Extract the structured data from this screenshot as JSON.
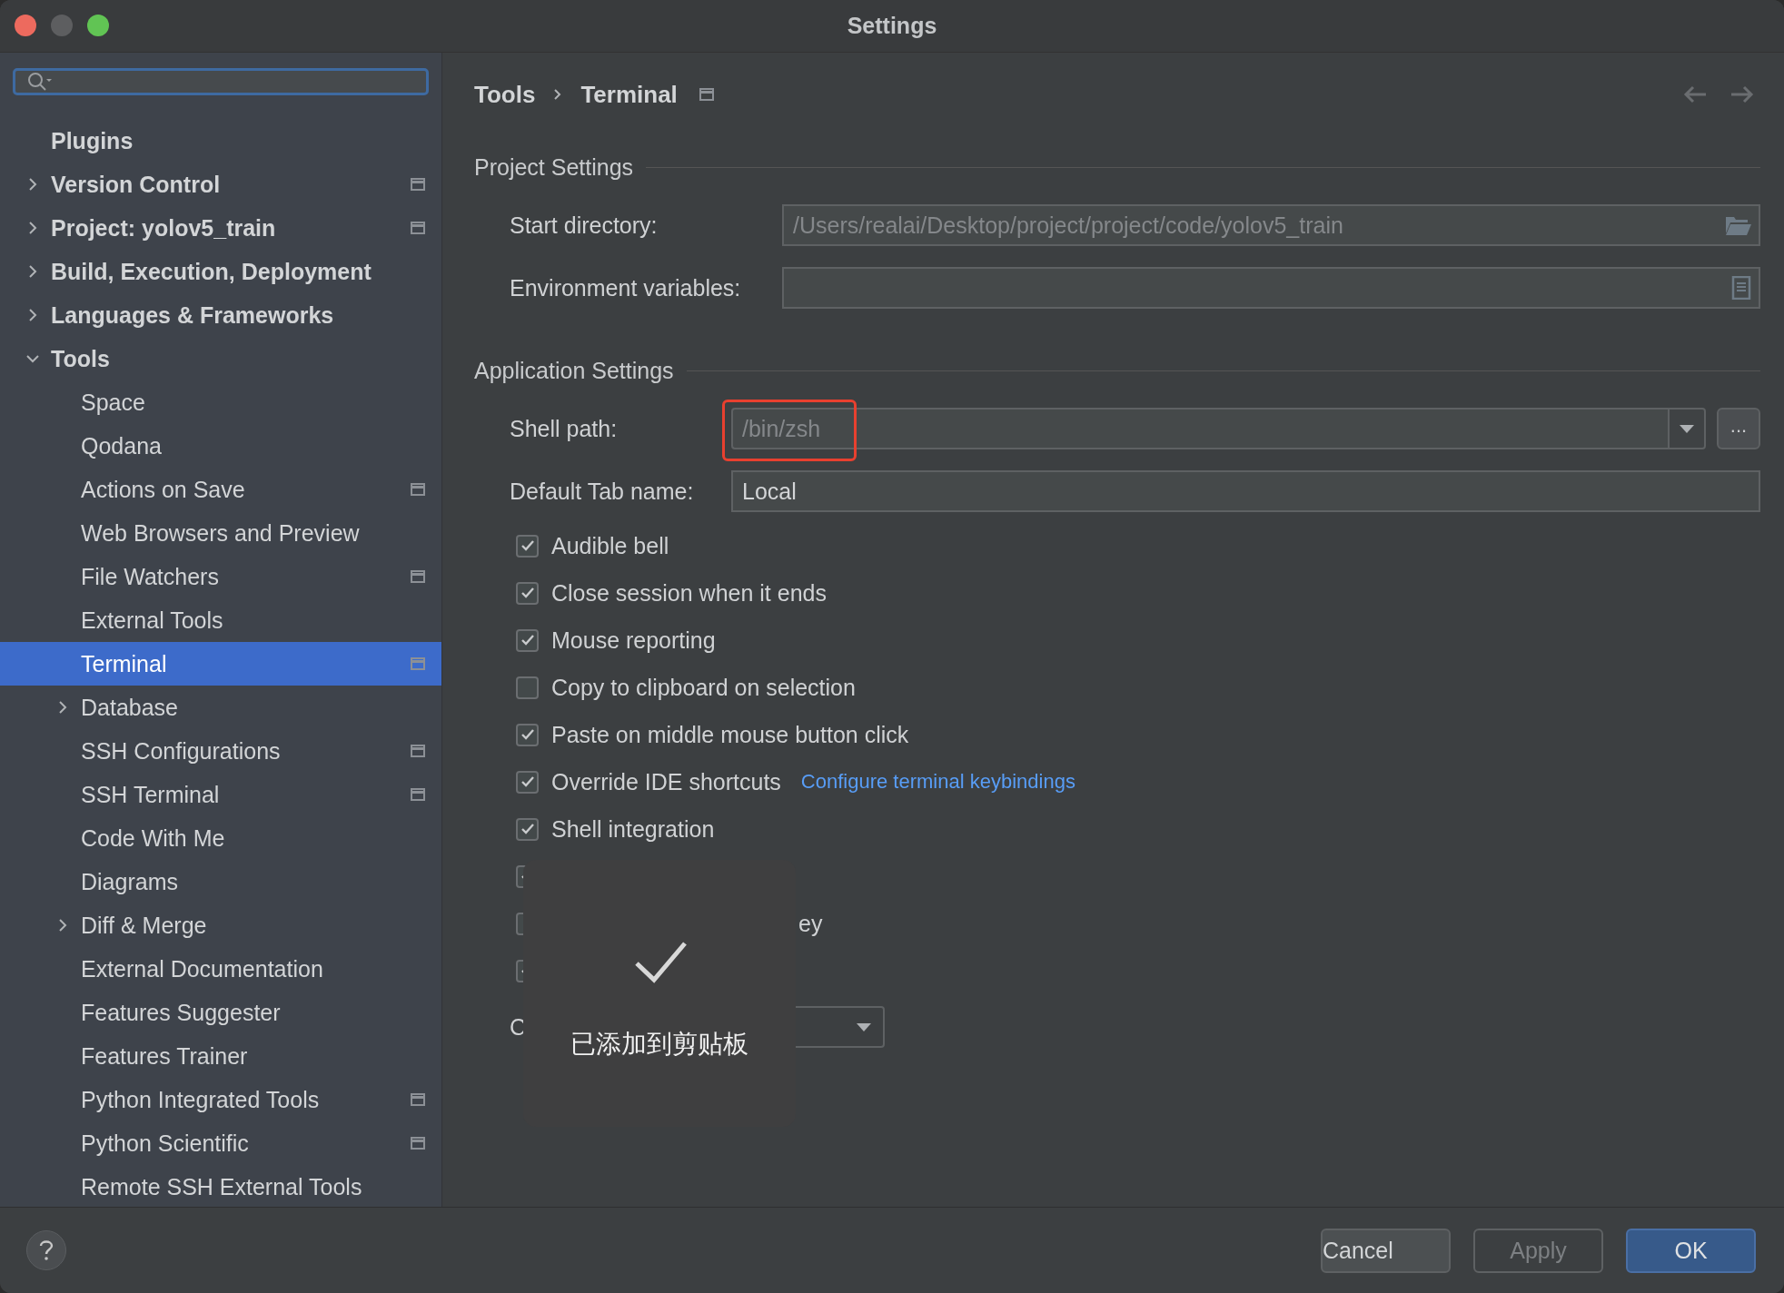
{
  "window": {
    "title": "Settings"
  },
  "sidebar": {
    "items": [
      {
        "label": "Plugins",
        "bold": true,
        "selected": false
      },
      {
        "label": "Version Control",
        "bold": true,
        "expanded": false,
        "scoped": true,
        "selected": false
      },
      {
        "label": "Project: yolov5_train",
        "bold": true,
        "expanded": false,
        "scoped": true,
        "selected": false
      },
      {
        "label": "Build, Execution, Deployment",
        "bold": true,
        "expanded": false,
        "selected": false
      },
      {
        "label": "Languages & Frameworks",
        "bold": true,
        "expanded": false,
        "selected": false
      },
      {
        "label": "Tools",
        "bold": true,
        "expanded": true,
        "selected": false,
        "children": [
          {
            "label": "Space",
            "selected": false
          },
          {
            "label": "Qodana",
            "selected": false
          },
          {
            "label": "Actions on Save",
            "scoped": true,
            "selected": false
          },
          {
            "label": "Web Browsers and Preview",
            "selected": false
          },
          {
            "label": "File Watchers",
            "scoped": true,
            "selected": false
          },
          {
            "label": "External Tools",
            "selected": false
          },
          {
            "label": "Terminal",
            "scoped": true,
            "selected": true
          },
          {
            "label": "Database",
            "expanded": false,
            "selected": false
          },
          {
            "label": "SSH Configurations",
            "scoped": true,
            "selected": false
          },
          {
            "label": "SSH Terminal",
            "scoped": true,
            "selected": false
          },
          {
            "label": "Code With Me",
            "selected": false
          },
          {
            "label": "Diagrams",
            "selected": false
          },
          {
            "label": "Diff & Merge",
            "expanded": false,
            "selected": false
          },
          {
            "label": "External Documentation",
            "selected": false
          },
          {
            "label": "Features Suggester",
            "selected": false
          },
          {
            "label": "Features Trainer",
            "selected": false
          },
          {
            "label": "Python Integrated Tools",
            "scoped": true,
            "selected": false
          },
          {
            "label": "Python Scientific",
            "scoped": true,
            "selected": false
          },
          {
            "label": "Remote SSH External Tools",
            "selected": false
          }
        ]
      }
    ]
  },
  "breadcrumb": {
    "items": [
      "Tools",
      "Terminal"
    ],
    "scoped": true
  },
  "project_settings": {
    "heading": "Project Settings",
    "fields": [
      {
        "label": "Start directory:",
        "placeholder": "/Users/realai/Desktop/project/project/code/yolov5_train",
        "kind": "folder"
      },
      {
        "label": "Environment variables:",
        "kind": "list"
      }
    ]
  },
  "application_settings": {
    "heading": "Application Settings",
    "shell_path": {
      "label": "Shell path:",
      "placeholder": "/bin/zsh",
      "highlighted": true,
      "browse": "..."
    },
    "tab_name": {
      "label": "Default Tab name:",
      "value": "Local"
    },
    "checkboxes": [
      {
        "label": "Audible bell",
        "checked": true
      },
      {
        "label": "Close session when it ends",
        "checked": true
      },
      {
        "label": "Mouse reporting",
        "checked": true
      },
      {
        "label": "Copy to clipboard on selection",
        "checked": false
      },
      {
        "label": "Paste on middle mouse button click",
        "checked": true
      },
      {
        "label": "Override IDE shortcuts",
        "checked": true,
        "link": "Configure terminal keybindings"
      },
      {
        "label": "Shell integration",
        "checked": true
      },
      {
        "checked": true,
        "kind": "covered"
      },
      {
        "label": "ey",
        "checked": false,
        "kind": "covered"
      },
      {
        "checked": true,
        "kind": "covered"
      }
    ],
    "dropdown_row": {
      "label": "C"
    }
  },
  "toast": {
    "text": "已添加到剪贴板"
  },
  "buttons": [
    {
      "label": "Cancel",
      "kind": "secondary"
    },
    {
      "label": "Apply",
      "kind": "disabled"
    },
    {
      "label": "OK",
      "kind": "primary"
    }
  ]
}
